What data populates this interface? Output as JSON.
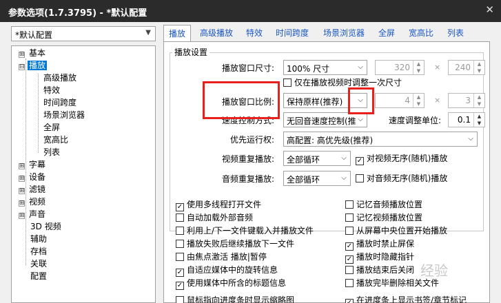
{
  "window": {
    "title": "参数选项(1.7.3795) - *默认配置",
    "close_icon": "close-icon"
  },
  "profile": {
    "selected": "*默认配置"
  },
  "tree": [
    {
      "label": "基本",
      "expand": "⊞"
    },
    {
      "label": "播放",
      "expand": "⊟"
    },
    {
      "label": "高级播放"
    },
    {
      "label": "特效"
    },
    {
      "label": "时间跨度"
    },
    {
      "label": "场景浏览器"
    },
    {
      "label": "全屏"
    },
    {
      "label": "宽高比"
    },
    {
      "label": "列表"
    },
    {
      "label": "字幕",
      "expand": "⊞"
    },
    {
      "label": "设备",
      "expand": "⊞"
    },
    {
      "label": "滤镜",
      "expand": "⊞"
    },
    {
      "label": "视频",
      "expand": "⊞"
    },
    {
      "label": "声音",
      "expand": "⊞"
    },
    {
      "label": "3D 视频"
    },
    {
      "label": "辅助"
    },
    {
      "label": "存档"
    },
    {
      "label": "关联"
    },
    {
      "label": "配置"
    }
  ],
  "tabs": [
    "播放",
    "高级播放",
    "特效",
    "时间跨度",
    "场景浏览器",
    "全屏",
    "宽高比",
    "列表"
  ],
  "group": {
    "title": "播放设置",
    "window_size_label": "播放窗口尺寸:",
    "window_size_value": "100% 尺寸",
    "width": "320",
    "height": "240",
    "times": "×",
    "only_once": "仅在播放视频时调整一次尺寸",
    "ratio_label": "播放窗口比例:",
    "ratio_value": "保持原样(推荐)",
    "ratio_w": "4",
    "ratio_h": "3",
    "speed_label": "速度控制方式:",
    "speed_value": "无回音速度控制(推",
    "speed_unit_label": "速度调整单位:",
    "speed_unit_value": "0.1",
    "priority_label": "优先运行权:",
    "priority_value": "高配置: 高优先级(推荐)",
    "video_repeat_label": "视频重复播放:",
    "video_repeat_value": "全部循环",
    "video_shuffle": "对视频无序(随机)播放",
    "audio_repeat_label": "音频重复播放:",
    "audio_repeat_value": "全部循环",
    "audio_shuffle": "对音频无序(随机)播放"
  },
  "options_left": [
    {
      "label": "使用多线程打开文件",
      "checked": true
    },
    {
      "label": "自动加载外部音频",
      "checked": false
    },
    {
      "label": "利用上/下一文件键载入并播放文件",
      "checked": false
    },
    {
      "label": "播放失败后继续播放下一文件",
      "checked": false
    },
    {
      "label": "由焦点激活 播放|暂停",
      "checked": false
    },
    {
      "label": "自适应媒体中的旋转信息",
      "checked": true
    },
    {
      "label": "使用媒体中所含的标题信息",
      "checked": true
    },
    {
      "label": "鼠标指向进度条时显示缩略图",
      "checked": false
    }
  ],
  "options_right": [
    {
      "label": "记忆音频播放位置",
      "checked": false
    },
    {
      "label": "记忆视频播放位置",
      "checked": false
    },
    {
      "label": "从屏幕中央位置开始播放",
      "checked": false
    },
    {
      "label": "播放时禁止屏保",
      "checked": true
    },
    {
      "label": "播放时隐藏指针",
      "checked": true
    },
    {
      "label": "播放结束后关闭",
      "checked": false
    },
    {
      "label": "播放完毕删除相关文件",
      "checked": false
    },
    {
      "label": "在进度条上显示书签/章节标记",
      "checked": true
    }
  ],
  "watermark": "经验"
}
